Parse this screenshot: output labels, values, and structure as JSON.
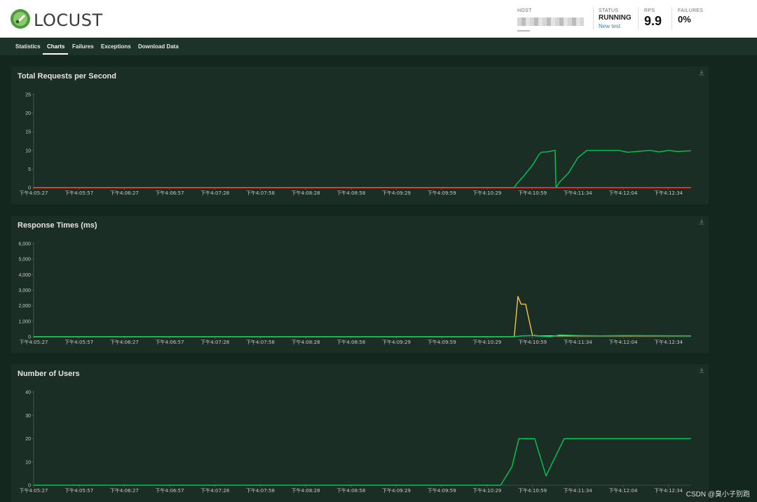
{
  "app": {
    "name": "LOCUST"
  },
  "header": {
    "host_label": "HOST",
    "status_label": "STATUS",
    "status_value": "RUNNING",
    "new_test_label": "New test",
    "rps_label": "RPS",
    "rps_value": "9.9",
    "failures_label": "FAILURES",
    "failures_value": "0%"
  },
  "nav": {
    "tabs": [
      "Statistics",
      "Charts",
      "Failures",
      "Exceptions",
      "Download Data"
    ],
    "active": "Charts"
  },
  "colors": {
    "background": "#14271f",
    "panel": "#1b2e25",
    "green_series": "#00c853",
    "red_series": "#ff3b3b",
    "yellow_series": "#f2c14e"
  },
  "x_ticks": [
    "下午4:05:27",
    "下午4:05:57",
    "下午4:06:27",
    "下午4:06:57",
    "下午4:07:28",
    "下午4:07:58",
    "下午4:08:28",
    "下午4:08:58",
    "下午4:09:29",
    "下午4:09:59",
    "下午4:10:29",
    "下午4:10:59",
    "下午4:11:34",
    "下午4:12:04",
    "下午4:12:34"
  ],
  "chart_data": [
    {
      "type": "line",
      "title": "Total Requests per Second",
      "ylim": [
        0,
        25
      ],
      "y_ticks": [
        "0",
        "5",
        "10",
        "15",
        "20",
        "25"
      ],
      "x_range": [
        0,
        14.5
      ],
      "series": [
        {
          "color": "#00c853",
          "x": [
            0,
            10.6,
            10.65,
            10.8,
            11.0,
            11.15,
            11.2,
            11.32,
            11.5,
            11.52,
            11.6,
            11.8,
            12.0,
            12.2,
            12.35,
            12.5,
            12.9,
            13.1,
            13.3,
            13.6,
            13.8,
            14.0,
            14.2,
            14.5
          ],
          "values": [
            0,
            0,
            1,
            3,
            6,
            9,
            9.5,
            9.6,
            10,
            0,
            1.5,
            4,
            8,
            10,
            10,
            10,
            10,
            9.5,
            9.7,
            10,
            9.6,
            10,
            9.7,
            9.9
          ]
        },
        {
          "color": "#ff3b3b",
          "x": [
            0,
            14.5
          ],
          "values": [
            0,
            0
          ]
        }
      ]
    },
    {
      "type": "line",
      "title": "Response Times (ms)",
      "ylim": [
        0,
        6000
      ],
      "y_ticks": [
        "0",
        "1,000",
        "2,000",
        "3,000",
        "4,000",
        "5,000",
        "6,000"
      ],
      "x_range": [
        0,
        14.5
      ],
      "series": [
        {
          "color": "#f2c14e",
          "x": [
            0,
            10.6,
            10.68,
            10.75,
            10.85,
            11.0,
            11.15,
            14.5
          ],
          "values": [
            0,
            0,
            2600,
            2100,
            2100,
            100,
            60,
            60
          ]
        },
        {
          "color": "#00c853",
          "x": [
            0,
            10.6,
            10.75,
            11.0,
            11.4,
            11.6,
            12.0,
            12.5,
            13.0,
            14.5
          ],
          "values": [
            0,
            0,
            60,
            80,
            0,
            120,
            80,
            60,
            80,
            60
          ]
        }
      ]
    },
    {
      "type": "line",
      "title": "Number of Users",
      "ylim": [
        0,
        40
      ],
      "y_ticks": [
        "0",
        "10",
        "20",
        "30",
        "40"
      ],
      "x_range": [
        0,
        14.5
      ],
      "series": [
        {
          "color": "#00c853",
          "x": [
            0,
            10.3,
            10.55,
            10.7,
            10.8,
            11.0,
            11.05,
            11.3,
            11.7,
            14.5
          ],
          "values": [
            0,
            0,
            8,
            20,
            20,
            20,
            20,
            4,
            20,
            20
          ]
        }
      ]
    }
  ],
  "footer": {
    "watermark": "CSDN @臭小子别跑"
  }
}
